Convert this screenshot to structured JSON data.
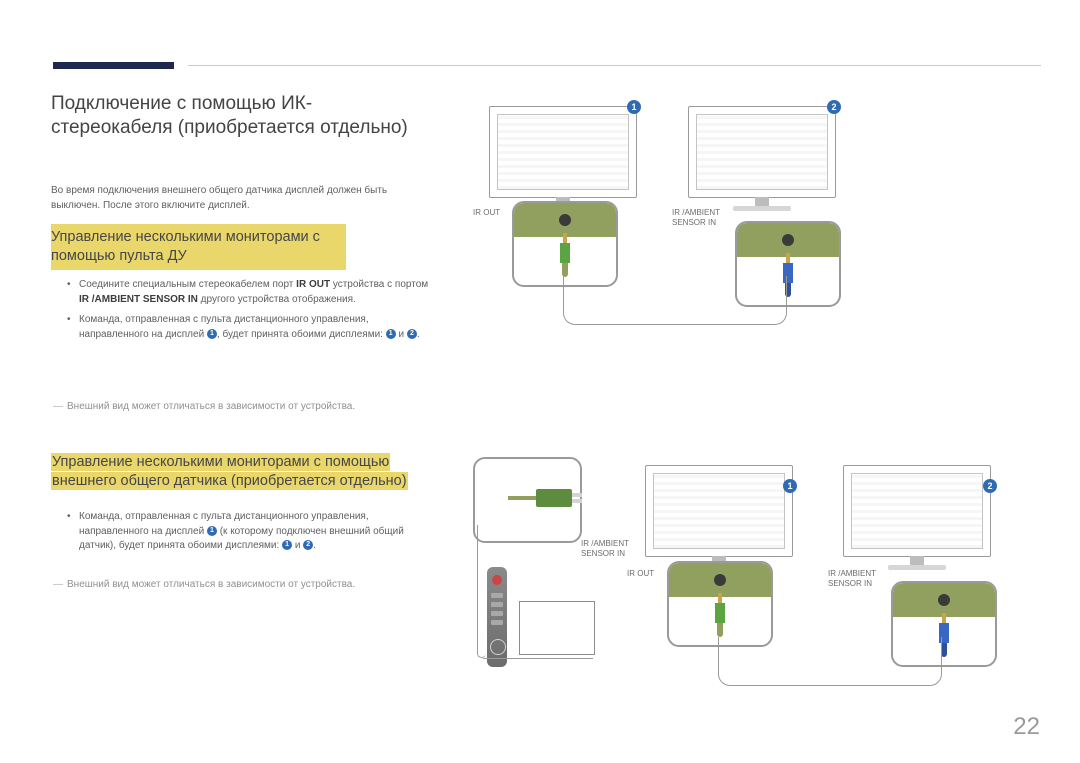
{
  "page_number": "22",
  "title": "Подключение с помощью ИК-стереокабеля (приобретается отдельно)",
  "intro_note": "Во время подключения внешнего общего датчика дисплей должен быть выключен. После этого включите дисплей.",
  "section1": {
    "heading": "Управление несколькими мониторами с помощью пульта ДУ",
    "bullets": [
      {
        "pre": "Соедините специальным стереокабелем порт ",
        "b1": "IR OUT",
        "mid": " устройства с портом ",
        "b2": "IR /AMBIENT SENSOR IN",
        "post": " другого устройства отображения."
      },
      {
        "pre": "Команда, отправленная с пульта дистанционного управления, направленного на дисплей ",
        "ref1": "1",
        "mid": ", будет принята обоими дисплеями: ",
        "ref2": "1",
        "and_word": " и ",
        "ref3": "2",
        "post": "."
      }
    ],
    "footnote": "Внешний вид может отличаться в зависимости от устройства."
  },
  "section2": {
    "heading_line1": "Управление несколькими мониторами с помощью",
    "heading_line2": "внешнего общего датчика (приобретается отдельно)",
    "bullet": {
      "pre": "Команда, отправленная с пульта дистанционного управления, направленного на дисплей ",
      "ref1": "1",
      "mid": " (к которому подключен внешний общий датчик), будет принята обоими дисплеями: ",
      "ref2": "1",
      "and_word": " и ",
      "ref3": "2",
      "post": "."
    },
    "footnote": "Внешний вид может отличаться в зависимости от устройства."
  },
  "diagram": {
    "ir_out": "IR OUT",
    "ir_ambient": "IR /AMBIENT SENSOR IN",
    "badge1": "1",
    "badge2": "2"
  }
}
